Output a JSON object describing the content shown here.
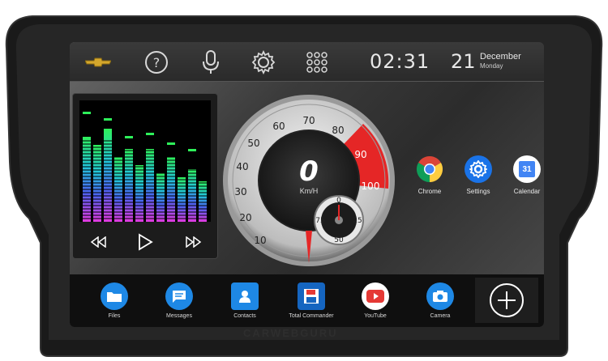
{
  "topbar": {
    "time": "02:31",
    "day": "21",
    "month": "December",
    "weekday": "Monday",
    "icons": [
      "chevrolet-logo",
      "help-icon",
      "microphone-icon",
      "settings-gear-icon",
      "app-grid-icon"
    ]
  },
  "music": {
    "controls": [
      "previous-icon",
      "play-icon",
      "next-icon"
    ]
  },
  "speedometer": {
    "speed": "0",
    "unit": "Km/H",
    "ticks": [
      "10",
      "20",
      "30",
      "40",
      "50",
      "60",
      "70",
      "80",
      "90",
      "100"
    ],
    "sub_ticks": [
      "0",
      "25",
      "50",
      "75"
    ]
  },
  "apps": [
    {
      "label": "Chrome",
      "icon": "chrome-icon"
    },
    {
      "label": "Settings",
      "icon": "settings-icon"
    },
    {
      "label": "Calendar",
      "icon": "calendar-icon",
      "badge": "31"
    }
  ],
  "dock": [
    {
      "label": "Files",
      "icon": "folder-icon",
      "color": "#1e88e5"
    },
    {
      "label": "Messages",
      "icon": "message-icon",
      "color": "#1e88e5"
    },
    {
      "label": "Contacts",
      "icon": "contacts-icon",
      "color": "#1e88e5"
    },
    {
      "label": "Total Commander",
      "icon": "floppy-disk-icon",
      "color": "#1565c0"
    },
    {
      "label": "YouTube",
      "icon": "youtube-icon",
      "color": "#e53935"
    },
    {
      "label": "Camera",
      "icon": "camera-icon",
      "color": "#1e88e5"
    }
  ],
  "brand": "CARWEBGURU"
}
